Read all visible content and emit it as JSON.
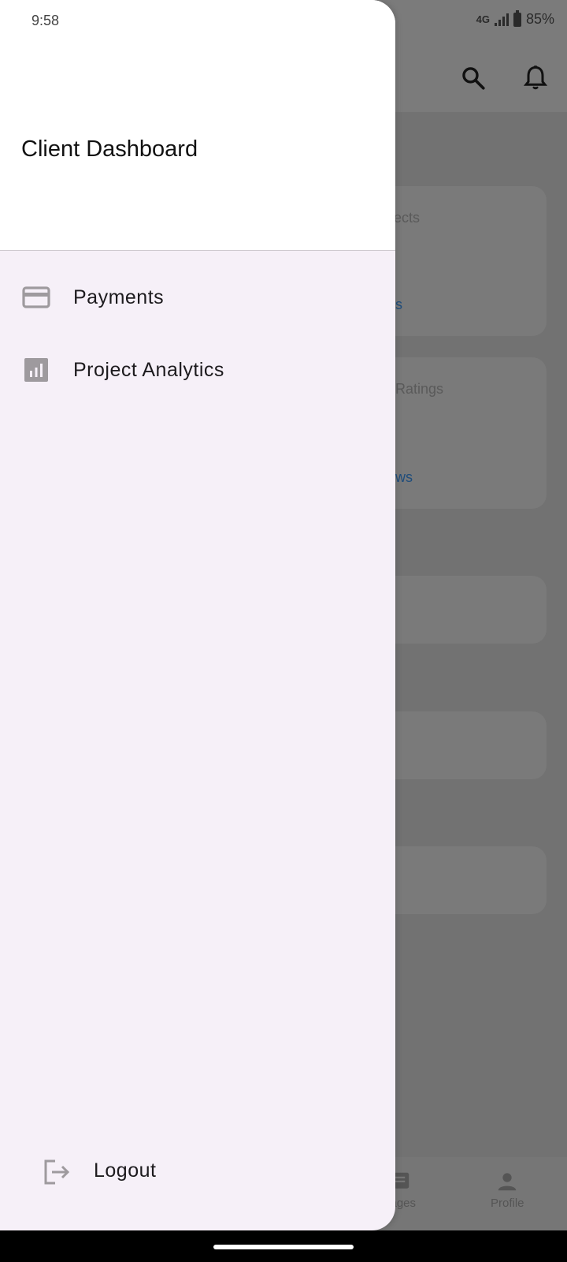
{
  "status_bar": {
    "time": "9:58",
    "network": "4G",
    "battery": "85%"
  },
  "drawer": {
    "title": "Client Dashboard",
    "items": [
      {
        "label": "Payments",
        "icon": "credit-card-icon"
      },
      {
        "label": "Project Analytics",
        "icon": "analytics-icon"
      }
    ],
    "logout_label": "Logout",
    "logout_icon": "logout-icon"
  },
  "background": {
    "cards": [
      {
        "title_fragment": "ects",
        "link_fragment": "s"
      },
      {
        "title_fragment": "Ratings",
        "link_fragment": "ws"
      }
    ],
    "bottom_nav": [
      {
        "label": "sages",
        "icon": "messages-icon"
      },
      {
        "label": "Profile",
        "icon": "person-icon"
      }
    ]
  },
  "colors": {
    "drawer_bg": "#f6f0f8",
    "header_bg": "#ffffff",
    "scrim": "#727272",
    "icon_gray": "#9e9a9e",
    "link_blue": "#1f4d7c"
  }
}
